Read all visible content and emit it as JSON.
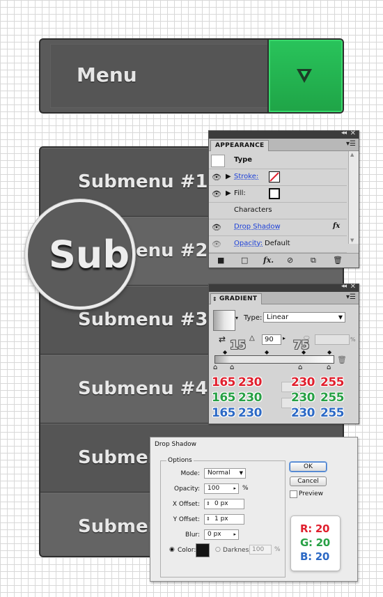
{
  "menu": {
    "label": "Menu",
    "toggle_icon": "triangle-down-icon",
    "accent": "#22b450"
  },
  "submenu": {
    "items": [
      {
        "label": "Submenu #1"
      },
      {
        "label": "Submenu #2"
      },
      {
        "label": "Submenu #3"
      },
      {
        "label": "Submenu #4"
      },
      {
        "label": "Submenu"
      },
      {
        "label": "Submenu"
      }
    ],
    "magnifier_text": "Subm"
  },
  "appearance": {
    "tab": "APPEARANCE",
    "header_label": "Type",
    "stroke_label": "Stroke:",
    "fill_label": "Fill:",
    "characters_label": "Characters",
    "drop_shadow_label": "Drop Shadow",
    "fx_label": "fx",
    "opacity_label": "Opacity:",
    "opacity_value": "Default"
  },
  "gradient": {
    "tab": "GRADIENT",
    "type_label": "Type:",
    "type_value": "Linear",
    "angle_value": "90",
    "number_15": "15",
    "number_75": "75",
    "percent": "%",
    "rows": [
      {
        "color": "red",
        "values": [
          "165",
          "230",
          "230",
          "255"
        ]
      },
      {
        "color": "green",
        "values": [
          "165",
          "230",
          "230",
          "255"
        ]
      },
      {
        "color": "blue",
        "values": [
          "165",
          "230",
          "230",
          "255"
        ]
      }
    ]
  },
  "drop_shadow": {
    "title": "Drop Shadow",
    "options_label": "Options",
    "mode_label": "Mode:",
    "mode_value": "Normal",
    "opacity_label": "Opacity:",
    "opacity_value": "100",
    "percent": "%",
    "x_offset_label": "X Offset:",
    "x_offset_value": "0 px",
    "y_offset_label": "Y Offset:",
    "y_offset_value": "1 px",
    "blur_label": "Blur:",
    "blur_value": "0 px",
    "color_label": "Color:",
    "darkness_label": "Darkness:",
    "darkness_value": "100",
    "ok_label": "OK",
    "cancel_label": "Cancel",
    "preview_label": "Preview",
    "rgb": {
      "r": "R: 20",
      "g": "G: 20",
      "b": "B: 20"
    }
  }
}
